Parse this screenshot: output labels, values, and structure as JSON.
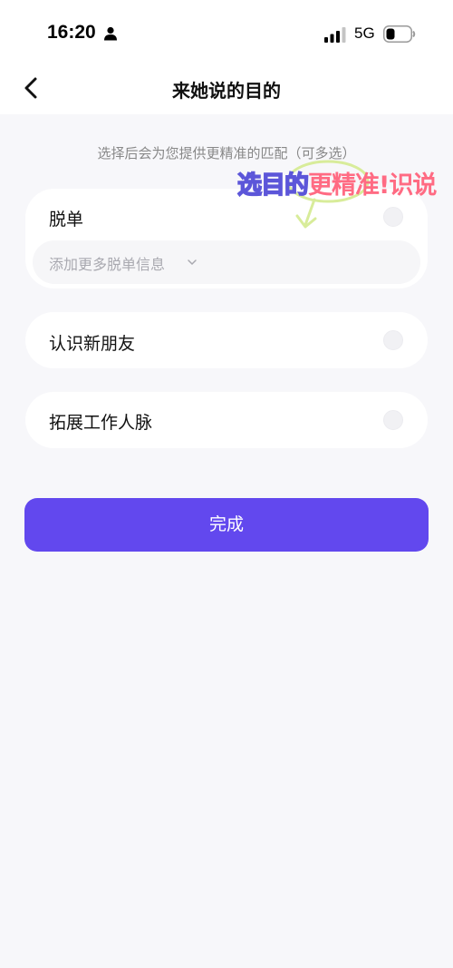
{
  "status_bar": {
    "time": "16:20",
    "network": "5G",
    "icons": [
      "person-icon",
      "signal-icon",
      "battery-icon"
    ]
  },
  "nav": {
    "back_icon": "chevron-left-icon",
    "title": "来她说的目的"
  },
  "hint": "选择后会为您提供更精准的匹配（可多选）",
  "options": [
    {
      "label": "脱单",
      "selected": false,
      "sub_placeholder": "添加更多脱单信息"
    },
    {
      "label": "认识新朋友",
      "selected": false
    },
    {
      "label": "拓展工作人脉",
      "selected": false
    }
  ],
  "watermark": {
    "part1": "选目的",
    "part2": "更精准!识说"
  },
  "done_button": "完成",
  "colors": {
    "accent": "#6248ee",
    "background": "#f7f7fa",
    "card": "#ffffff",
    "hint": "#888888"
  }
}
